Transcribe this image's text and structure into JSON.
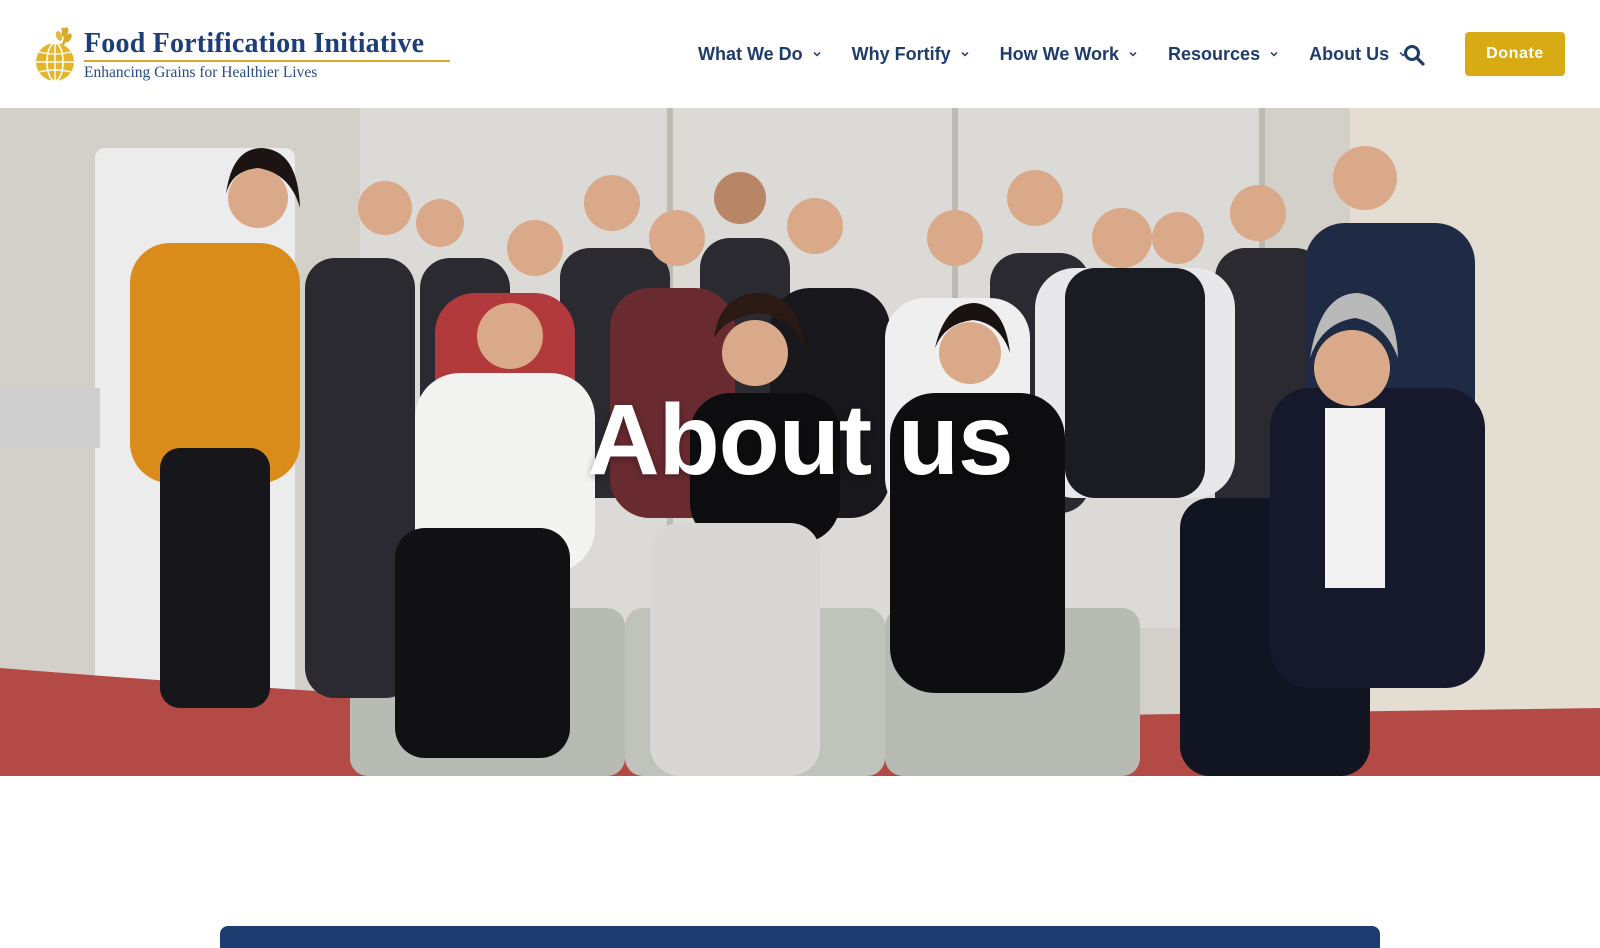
{
  "brand": {
    "title": "Food Fortification Initiative",
    "tagline": "Enhancing Grains for Healthier Lives",
    "colors": {
      "navy": "#1d3e78",
      "gold": "#d8aa14"
    }
  },
  "nav": {
    "items": [
      {
        "label": "What We Do"
      },
      {
        "label": "Why Fortify"
      },
      {
        "label": "How We Work"
      },
      {
        "label": "Resources"
      },
      {
        "label": "About Us"
      }
    ],
    "search_icon": "search-icon",
    "donate_label": "Donate"
  },
  "hero": {
    "title": "About us"
  }
}
